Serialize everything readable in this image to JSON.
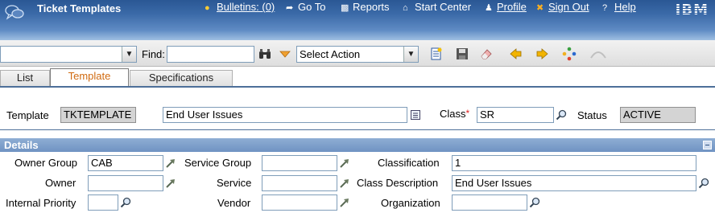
{
  "header": {
    "title": "Ticket Templates",
    "nav": {
      "bulletins": "Bulletins: (0)",
      "goto": "Go To",
      "reports": "Reports",
      "start_center": "Start Center",
      "profile": "Profile",
      "sign_out": "Sign Out",
      "help": "Help"
    },
    "logo": "IBM"
  },
  "toolbar": {
    "find_label": "Find:",
    "find_value": "",
    "select_action": "Select Action"
  },
  "tabs": [
    "List",
    "Template",
    "Specifications"
  ],
  "active_tab": "Template",
  "main": {
    "template_label": "Template",
    "template_value": "TKTEMPLATE",
    "description_value": "End User Issues",
    "class_label": "Class",
    "class_required_mark": "*",
    "class_value": "SR",
    "status_label": "Status",
    "status_value": "ACTIVE"
  },
  "details": {
    "section_title": "Details",
    "owner_group_label": "Owner Group",
    "owner_group_value": "CAB",
    "owner_label": "Owner",
    "owner_value": "",
    "internal_priority_label": "Internal Priority",
    "internal_priority_value": "",
    "service_group_label": "Service Group",
    "service_group_value": "",
    "service_label": "Service",
    "service_value": "",
    "vendor_label": "Vendor",
    "vendor_value": "",
    "classification_label": "Classification",
    "classification_value": "1",
    "class_description_label": "Class Description",
    "class_description_value": "End User Issues",
    "organization_label": "Organization",
    "organization_value": ""
  },
  "colors": {
    "header_blue": "#3b6aa8",
    "section_blue": "#7f9fcd",
    "active_tab_text": "#d06a10",
    "required_star": "#e02020"
  }
}
